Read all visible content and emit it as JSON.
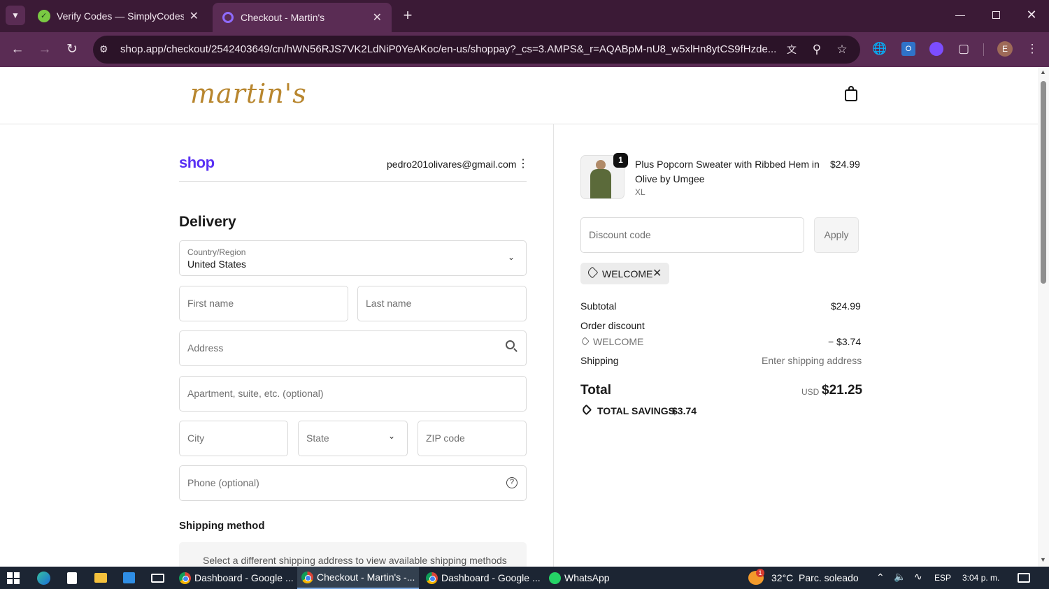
{
  "browser": {
    "tabs": [
      {
        "title": "Verify Codes — SimplyCodes",
        "close": "✕"
      },
      {
        "title": "Checkout - Martin's",
        "close": "✕"
      }
    ],
    "new_tab": "+",
    "url": "shop.app/checkout/2542403649/cn/hWN56RJS7VK2LdNiP0YeAKoc/en-us/shoppay?_cs=3.AMPS&_r=AQABpM-nU8_w5xlHn8ytCS9fHzde...",
    "profile_initial": "E",
    "accent": "#5a2c54"
  },
  "store": {
    "logo_text": "martin's",
    "logo_color": "#b8862e"
  },
  "account": {
    "brand": "shop",
    "brand_color": "#5a31f4",
    "email": "pedro201olivares@gmail.com"
  },
  "delivery": {
    "heading": "Delivery",
    "country_label": "Country/Region",
    "country_value": "United States",
    "first_name_placeholder": "First name",
    "last_name_placeholder": "Last name",
    "address_placeholder": "Address",
    "apartment_placeholder": "Apartment, suite, etc. (optional)",
    "city_placeholder": "City",
    "state_placeholder": "State",
    "zip_placeholder": "ZIP code",
    "phone_placeholder": "Phone (optional)"
  },
  "shipping_method": {
    "heading": "Shipping method",
    "note": "Select a different shipping address to view available shipping methods"
  },
  "order": {
    "item": {
      "quantity": "1",
      "name": "Plus Popcorn Sweater with Ribbed Hem in Olive by Umgee",
      "variant": "XL",
      "price": "$24.99"
    },
    "discount_placeholder": "Discount code",
    "apply_label": "Apply",
    "applied_code": "WELCOME",
    "subtotal_label": "Subtotal",
    "subtotal_value": "$24.99",
    "order_discount_label": "Order discount",
    "discount_code": "WELCOME",
    "discount_value": "− $3.74",
    "shipping_label": "Shipping",
    "shipping_value": "Enter shipping address",
    "total_label": "Total",
    "currency": "USD",
    "total_value": "$21.25",
    "savings_label": "TOTAL SAVINGS",
    "savings_value": "$3.74"
  },
  "taskbar": {
    "apps": [
      {
        "label": "Dashboard - Google ..."
      },
      {
        "label": "Checkout - Martin's -..."
      },
      {
        "label": "Dashboard - Google ..."
      },
      {
        "label": "WhatsApp"
      }
    ],
    "weather_badge": "1",
    "weather": "32°C  Parc. soleado",
    "language": "ESP",
    "time": "3:04 p. m."
  }
}
